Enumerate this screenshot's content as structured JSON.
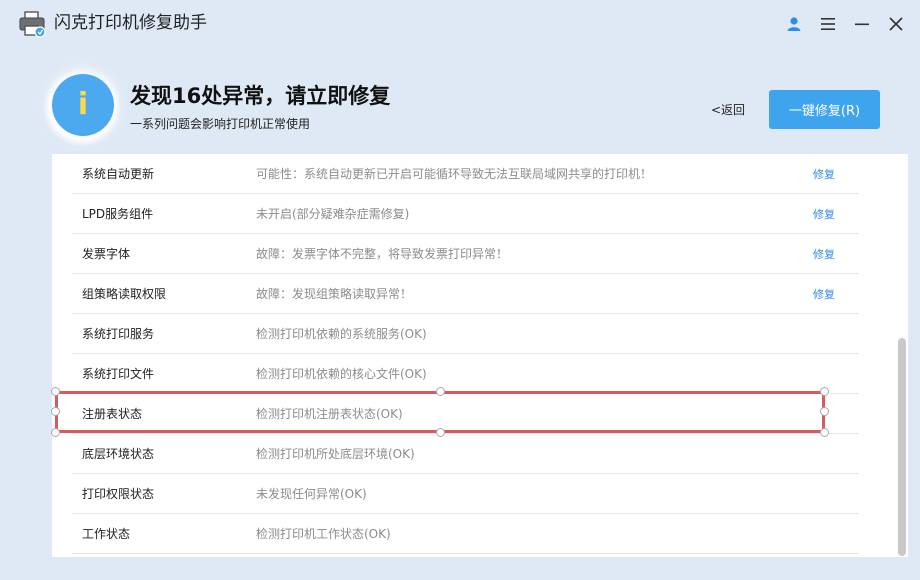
{
  "window": {
    "title": "闪克打印机修复助手",
    "icons": {
      "app": "printer-icon",
      "user": "user-icon",
      "menu": "menu-icon",
      "minimize": "minimize-icon",
      "close": "close-icon"
    }
  },
  "header": {
    "info_icon_glyph": "i",
    "title": "发现16处异常，请立即修复",
    "subtitle": "一系列问题会影响打印机正常使用",
    "back_label": "<返回",
    "fix_all_label": "一键修复(R)"
  },
  "colors": {
    "accent": "#3fa4ee",
    "link": "#2f8be8",
    "info_icon": "#4da9ef",
    "selection": "#d9595c"
  },
  "items": [
    {
      "name": "系统自动更新",
      "desc": "可能性：系统自动更新已开启可能循环导致无法互联局域网共享的打印机！",
      "action": "修复"
    },
    {
      "name": "LPD服务组件",
      "desc": "未开启(部分疑难杂症需修复)",
      "action": "修复"
    },
    {
      "name": "发票字体",
      "desc": "故障：发票字体不完整，将导致发票打印异常！",
      "action": "修复"
    },
    {
      "name": "组策略读取权限",
      "desc": "故障：发现组策略读取异常！",
      "action": "修复"
    },
    {
      "name": "系统打印服务",
      "desc": "检测打印机依赖的系统服务(OK)",
      "action": ""
    },
    {
      "name": "系统打印文件",
      "desc": "检测打印机依赖的核心文件(OK)",
      "action": ""
    },
    {
      "name": "注册表状态",
      "desc": "检测打印机注册表状态(OK)",
      "action": ""
    },
    {
      "name": "底层环境状态",
      "desc": "检测打印机所处底层环境(OK)",
      "action": ""
    },
    {
      "name": "打印权限状态",
      "desc": "未发现任何异常(OK)",
      "action": ""
    },
    {
      "name": "工作状态",
      "desc": "检测打印机工作状态(OK)",
      "action": ""
    }
  ]
}
